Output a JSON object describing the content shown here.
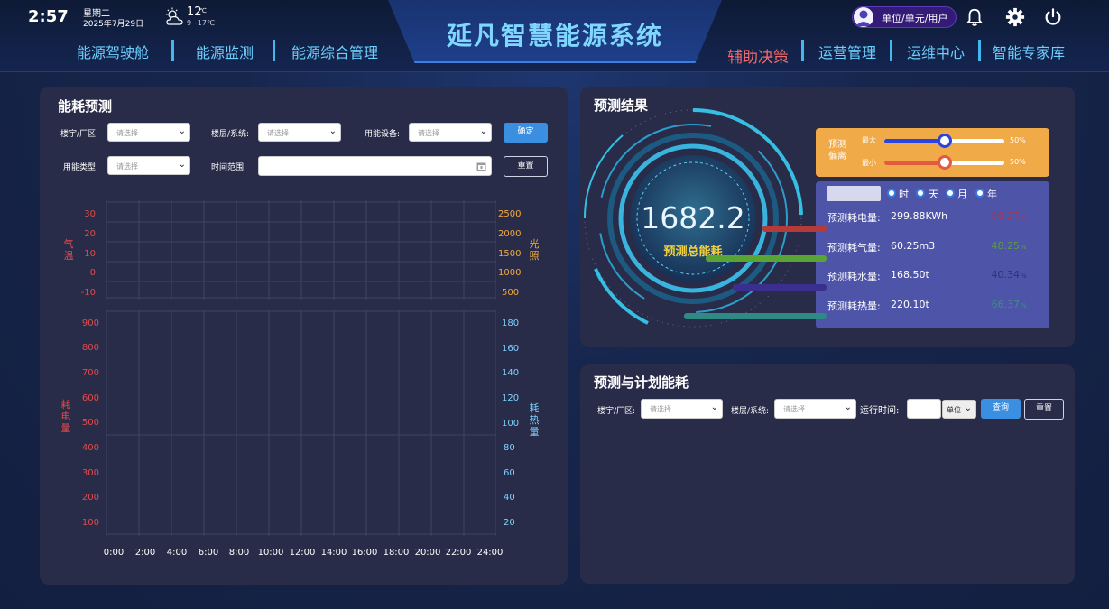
{
  "header": {
    "clock": "2:57",
    "weekday": "星期二",
    "date": "2025年7月29日",
    "temp": "12",
    "temp_unit": "℃",
    "temp_range": "9~17℃",
    "app_title": "延凡智慧能源系统",
    "nav_left": [
      "能源驾驶舱",
      "能源监测",
      "能源综合管理"
    ],
    "nav_right": [
      "辅助决策",
      "运营管理",
      "运维中心",
      "智能专家库"
    ],
    "active_nav": "辅助决策",
    "user_label": "单位/单元/用户",
    "icons": [
      "user-avatar-icon",
      "bell-icon",
      "gear-icon",
      "power-icon"
    ]
  },
  "forecast": {
    "title": "能耗预测",
    "filters": {
      "building_label": "楼宇/厂区:",
      "floor_label": "楼层/系统:",
      "device_label": "用能设备:",
      "type_label": "用能类型:",
      "time_label": "时间范围:",
      "placeholder": "请选择",
      "confirm": "确定",
      "reset": "重置"
    },
    "chart_top": {
      "left_label": [
        "气",
        "温"
      ],
      "right_label": [
        "光",
        "照"
      ],
      "left_ticks": [
        "30",
        "20",
        "10",
        "0",
        "-10"
      ],
      "right_ticks": [
        "2500",
        "2000",
        "1500",
        "1000",
        "500"
      ]
    },
    "chart_bottom": {
      "left_label": [
        "耗",
        "电",
        "量"
      ],
      "right_label": [
        "耗",
        "热",
        "量"
      ],
      "left_ticks": [
        "900",
        "800",
        "700",
        "600",
        "500",
        "400",
        "300",
        "200",
        "100"
      ],
      "right_ticks": [
        "180",
        "160",
        "140",
        "120",
        "100",
        "80",
        "60",
        "40",
        "20"
      ]
    },
    "x_ticks": [
      "0:00",
      "2:00",
      "4:00",
      "6:00",
      "8:00",
      "10:00",
      "12:00",
      "14:00",
      "16:00",
      "18:00",
      "20:00",
      "22:00",
      "24:00"
    ]
  },
  "result": {
    "title": "预测结果",
    "total_value": "1682.2",
    "total_label": "预测总能耗",
    "deviation_label": [
      "预测",
      "偏离"
    ],
    "max_label": "最大",
    "min_label": "最小",
    "max_pct": "50%",
    "min_pct": "50%",
    "max_level": 0.5,
    "min_level": 0.5,
    "periods": [
      "时",
      "天",
      "月",
      "年"
    ],
    "items": [
      {
        "label": "预测耗电量:",
        "value": "299.88KWh",
        "pct": "58.27",
        "color": "#b53a3a",
        "pct_color": "#a03858"
      },
      {
        "label": "预测耗气量:",
        "value": "60.25m3",
        "pct": "48.25",
        "color": "#58a535",
        "pct_color": "#5a9c45"
      },
      {
        "label": "预测耗水量:",
        "value": "168.50t",
        "pct": "40.34",
        "color": "#3a2f8e",
        "pct_color": "#30307a"
      },
      {
        "label": "预测耗热量:",
        "value": "220.10t",
        "pct": "66.37",
        "color": "#2f8a85",
        "pct_color": "#3f8a8a"
      }
    ],
    "pct_suffix": "%"
  },
  "plan": {
    "title": "预测与计划能耗",
    "building_label": "楼宇/厂区:",
    "floor_label": "楼层/系统:",
    "runtime_label": "运行时间:",
    "placeholder": "请选择",
    "unit": "单位",
    "query": "查询",
    "reset": "重置"
  }
}
